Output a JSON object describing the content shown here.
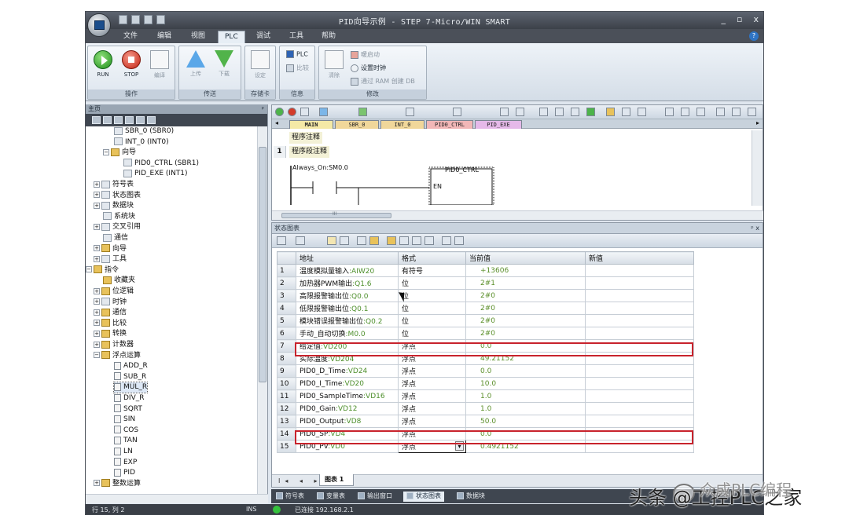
{
  "window": {
    "title": "PID向导示例 - STEP 7-Micro/WIN SMART",
    "controls": [
      "_",
      "▫",
      "x"
    ]
  },
  "menu": {
    "tabs": [
      "文件",
      "编辑",
      "视图",
      "PLC",
      "调试",
      "工具",
      "帮助"
    ],
    "active": "PLC",
    "help": "?"
  },
  "ribbon": {
    "groups": [
      {
        "label": "操作",
        "buttons": [
          "RUN",
          "STOP",
          "编译"
        ]
      },
      {
        "label": "传送",
        "buttons": [
          "上传",
          "下载"
        ]
      },
      {
        "label": "存储卡",
        "buttons": [
          "设定"
        ]
      },
      {
        "label": "信息",
        "buttons": [
          "PLC",
          "比较"
        ]
      },
      {
        "label": "修改",
        "buttons": [
          "清除",
          "暖启动",
          "设置时钟",
          "通过 RAM 创建 DB"
        ]
      }
    ]
  },
  "left_pane": {
    "title": "主页",
    "pin": "ᵖ",
    "tree": [
      {
        "label": "SBR_0 (SBR0)",
        "icon": "program-icon"
      },
      {
        "label": "INT_0 (INT0)",
        "icon": "program-icon"
      },
      {
        "label": "向导",
        "icon": "wizard-icon",
        "expander": "−"
      },
      {
        "label": "PID0_CTRL (SBR1)",
        "icon": "program-icon"
      },
      {
        "label": "PID_EXE (INT1)",
        "icon": "program-icon"
      },
      {
        "label": "符号表",
        "icon": "table-icon",
        "expander": "+"
      },
      {
        "label": "状态图表",
        "icon": "table-icon",
        "expander": "+"
      },
      {
        "label": "数据块",
        "icon": "table-icon",
        "expander": "+"
      },
      {
        "label": "系统块",
        "icon": "system-icon"
      },
      {
        "label": "交叉引用",
        "icon": "table-icon",
        "expander": "+"
      },
      {
        "label": "通信",
        "icon": "comm-icon"
      },
      {
        "label": "向导",
        "icon": "wizard-icon",
        "expander": "+"
      },
      {
        "label": "工具",
        "icon": "tool-icon",
        "expander": "+"
      },
      {
        "label": "指令",
        "icon": "book-icon",
        "expander": "−"
      },
      {
        "label": "收藏夹",
        "icon": "folder-icon"
      },
      {
        "label": "位逻辑",
        "icon": "folder-icon",
        "expander": "+"
      },
      {
        "label": "时钟",
        "icon": "clock-icon",
        "expander": "+"
      },
      {
        "label": "通信",
        "icon": "folder-icon",
        "expander": "+"
      },
      {
        "label": "比较",
        "icon": "folder-icon",
        "expander": "+"
      },
      {
        "label": "转换",
        "icon": "folder-icon",
        "expander": "+"
      },
      {
        "label": "计数器",
        "icon": "folder-icon",
        "expander": "+"
      },
      {
        "label": "浮点运算",
        "icon": "folder-icon",
        "expander": "−"
      },
      {
        "label": "ADD_R",
        "icon": "instruction-icon"
      },
      {
        "label": "SUB_R",
        "icon": "instruction-icon"
      },
      {
        "label": "MUL_R",
        "icon": "instruction-icon"
      },
      {
        "label": "DIV_R",
        "icon": "instruction-icon"
      },
      {
        "label": "SQRT",
        "icon": "instruction-icon"
      },
      {
        "label": "SIN",
        "icon": "instruction-icon"
      },
      {
        "label": "COS",
        "icon": "instruction-icon"
      },
      {
        "label": "TAN",
        "icon": "instruction-icon"
      },
      {
        "label": "LN",
        "icon": "instruction-icon"
      },
      {
        "label": "EXP",
        "icon": "instruction-icon"
      },
      {
        "label": "PID",
        "icon": "instruction-icon"
      },
      {
        "label": "整数运算",
        "icon": "folder-icon",
        "expander": "+"
      }
    ]
  },
  "editor": {
    "tabs": [
      "MAIN",
      "SBR_0",
      "INT_0",
      "PID0_CTRL",
      "PID_EXE"
    ],
    "program_comment": "程序注释",
    "network_number": "1",
    "network_comment": "程序段注释",
    "contact_label": "Always_On:SM0.0",
    "box_name": "PID0_CTRL",
    "box_input": "EN",
    "scroll_text": "III"
  },
  "status_chart": {
    "title": "状态图表",
    "ctrl_text": "ᵖ x",
    "columns": [
      "地址",
      "格式",
      "当前值",
      "新值"
    ],
    "rows": [
      {
        "n": "1",
        "name": "温度模拟量输入",
        "op": ":AIW20",
        "fmt": "有符号",
        "val": "+13606",
        "new": ""
      },
      {
        "n": "2",
        "name": "加热器PWM输出",
        "op": ":Q1.6",
        "fmt": "位",
        "val": "2#1",
        "new": ""
      },
      {
        "n": "3",
        "name": "高限报警输出位",
        "op": ":Q0.0",
        "fmt": "位",
        "val": "2#0",
        "new": ""
      },
      {
        "n": "4",
        "name": "低限报警输出位",
        "op": ":Q0.1",
        "fmt": "位",
        "val": "2#0",
        "new": ""
      },
      {
        "n": "5",
        "name": "模块错误报警输出位",
        "op": ":Q0.2",
        "fmt": "位",
        "val": "2#0",
        "new": ""
      },
      {
        "n": "6",
        "name": "手动_自动切换",
        "op": ":M0.0",
        "fmt": "位",
        "val": "2#0",
        "new": "",
        "highlight": true
      },
      {
        "n": "7",
        "name": "给定值",
        "op": ":VD200",
        "fmt": "浮点",
        "val": "0.0",
        "new": ""
      },
      {
        "n": "8",
        "name": "实际温度",
        "op": ":VD204",
        "fmt": "浮点",
        "val": "49.21152",
        "new": ""
      },
      {
        "n": "9",
        "name": "PID0_D_Time",
        "op": ":VD24",
        "fmt": "浮点",
        "val": "0.0",
        "new": ""
      },
      {
        "n": "10",
        "name": "PID0_I_Time",
        "op": ":VD20",
        "fmt": "浮点",
        "val": "10.0",
        "new": ""
      },
      {
        "n": "11",
        "name": "PID0_SampleTime",
        "op": ":VD16",
        "fmt": "浮点",
        "val": "1.0",
        "new": ""
      },
      {
        "n": "12",
        "name": "PID0_Gain",
        "op": ":VD12",
        "fmt": "浮点",
        "val": "1.0",
        "new": ""
      },
      {
        "n": "13",
        "name": "PID0_Output",
        "op": ":VD8",
        "fmt": "浮点",
        "val": "50.0",
        "new": "",
        "highlight": true
      },
      {
        "n": "14",
        "name": "PID0_SP",
        "op": ":VD4",
        "fmt": "浮点",
        "val": "0.0",
        "new": ""
      },
      {
        "n": "15",
        "name": "PID0_PV",
        "op": ":VD0",
        "fmt": "浮点",
        "val": "0.4921152",
        "new": ""
      }
    ],
    "sheet_nav": "I◂ ◂ ▸ ▸I",
    "sheet_tab": "图表 1"
  },
  "window_tabs": [
    {
      "label": "符号表",
      "active": false
    },
    {
      "label": "变量表",
      "active": false
    },
    {
      "label": "输出窗口",
      "active": false
    },
    {
      "label": "状态图表",
      "active": true
    },
    {
      "label": "数据块",
      "active": false
    }
  ],
  "statusbar": {
    "position": "行 15, 列 2",
    "mode": "INS",
    "connection": "已连接 192.168.2.1"
  },
  "watermark": {
    "text": "头条 @工控PLC之家",
    "overlay": "众成PLC编程"
  },
  "colors": {
    "highlight_border": "#c8232c",
    "value_text": "#5b8f2a",
    "dark_chrome": "#3f4650"
  }
}
